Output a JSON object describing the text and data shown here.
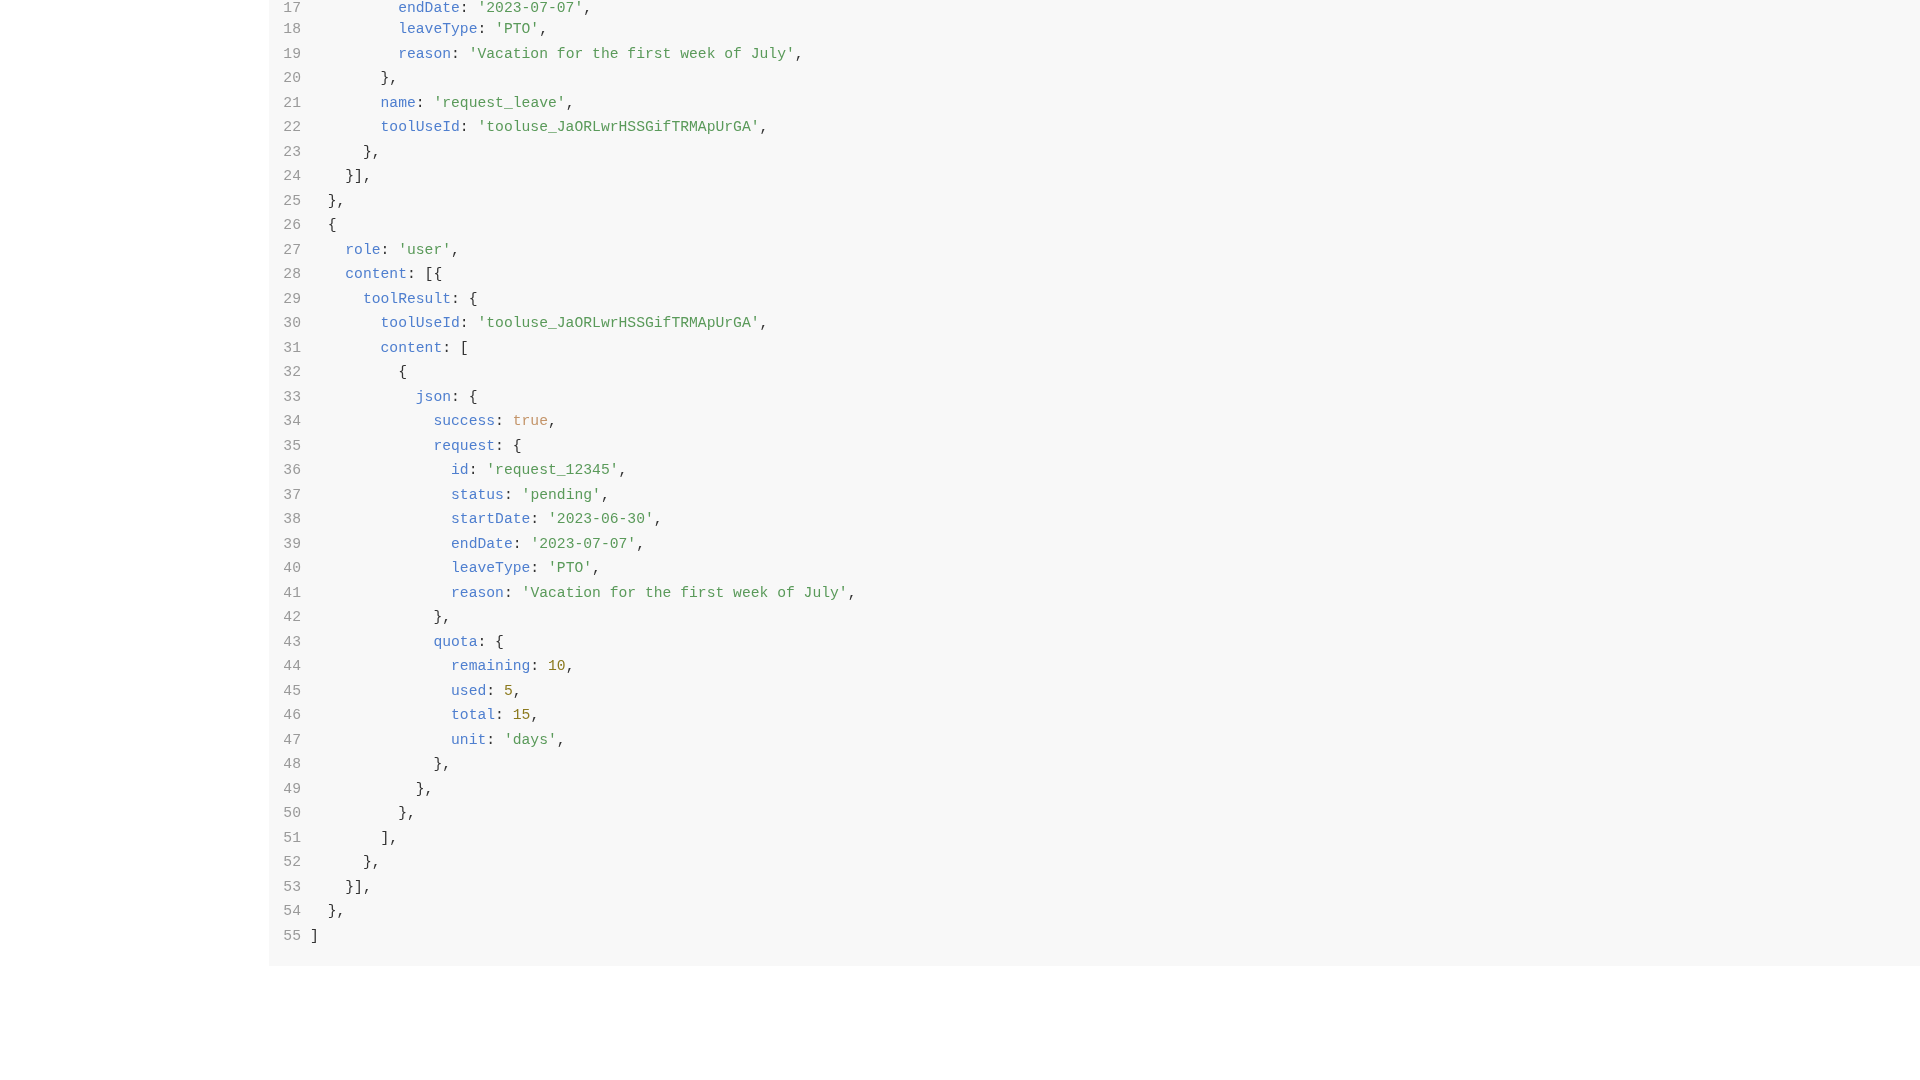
{
  "code_block": {
    "lines": [
      {
        "number": "17",
        "tokens": [
          {
            "kind": "key",
            "text": "          endDate"
          },
          {
            "kind": "punct",
            "text": ": "
          },
          {
            "kind": "string",
            "text": "'2023-07-07'"
          },
          {
            "kind": "punct",
            "text": ","
          }
        ]
      },
      {
        "number": "18",
        "tokens": [
          {
            "kind": "key",
            "text": "          leaveType"
          },
          {
            "kind": "punct",
            "text": ": "
          },
          {
            "kind": "string",
            "text": "'PTO'"
          },
          {
            "kind": "punct",
            "text": ","
          }
        ]
      },
      {
        "number": "19",
        "tokens": [
          {
            "kind": "key",
            "text": "          reason"
          },
          {
            "kind": "punct",
            "text": ": "
          },
          {
            "kind": "string",
            "text": "'Vacation for the first week of July'"
          },
          {
            "kind": "punct",
            "text": ","
          }
        ]
      },
      {
        "number": "20",
        "tokens": [
          {
            "kind": "punct",
            "text": "        },"
          }
        ]
      },
      {
        "number": "21",
        "tokens": [
          {
            "kind": "key",
            "text": "        name"
          },
          {
            "kind": "punct",
            "text": ": "
          },
          {
            "kind": "string",
            "text": "'request_leave'"
          },
          {
            "kind": "punct",
            "text": ","
          }
        ]
      },
      {
        "number": "22",
        "tokens": [
          {
            "kind": "key",
            "text": "        toolUseId"
          },
          {
            "kind": "punct",
            "text": ": "
          },
          {
            "kind": "string",
            "text": "'tooluse_JaORLwrHSSGifTRMApUrGA'"
          },
          {
            "kind": "punct",
            "text": ","
          }
        ]
      },
      {
        "number": "23",
        "tokens": [
          {
            "kind": "punct",
            "text": "      },"
          }
        ]
      },
      {
        "number": "24",
        "tokens": [
          {
            "kind": "punct",
            "text": "    }],"
          }
        ]
      },
      {
        "number": "25",
        "tokens": [
          {
            "kind": "punct",
            "text": "  },"
          }
        ]
      },
      {
        "number": "26",
        "tokens": [
          {
            "kind": "punct",
            "text": "  {"
          }
        ]
      },
      {
        "number": "27",
        "tokens": [
          {
            "kind": "key",
            "text": "    role"
          },
          {
            "kind": "punct",
            "text": ": "
          },
          {
            "kind": "string",
            "text": "'user'"
          },
          {
            "kind": "punct",
            "text": ","
          }
        ]
      },
      {
        "number": "28",
        "tokens": [
          {
            "kind": "key",
            "text": "    content"
          },
          {
            "kind": "punct",
            "text": ": [{"
          }
        ]
      },
      {
        "number": "29",
        "tokens": [
          {
            "kind": "key",
            "text": "      toolResult"
          },
          {
            "kind": "punct",
            "text": ": {"
          }
        ]
      },
      {
        "number": "30",
        "tokens": [
          {
            "kind": "key",
            "text": "        toolUseId"
          },
          {
            "kind": "punct",
            "text": ": "
          },
          {
            "kind": "string",
            "text": "'tooluse_JaORLwrHSSGifTRMApUrGA'"
          },
          {
            "kind": "punct",
            "text": ","
          }
        ]
      },
      {
        "number": "31",
        "tokens": [
          {
            "kind": "key",
            "text": "        content"
          },
          {
            "kind": "punct",
            "text": ": ["
          }
        ]
      },
      {
        "number": "32",
        "tokens": [
          {
            "kind": "punct",
            "text": "          {"
          }
        ]
      },
      {
        "number": "33",
        "tokens": [
          {
            "kind": "key",
            "text": "            json"
          },
          {
            "kind": "punct",
            "text": ": {"
          }
        ]
      },
      {
        "number": "34",
        "tokens": [
          {
            "kind": "key",
            "text": "              success"
          },
          {
            "kind": "punct",
            "text": ": "
          },
          {
            "kind": "boolean",
            "text": "true"
          },
          {
            "kind": "punct",
            "text": ","
          }
        ]
      },
      {
        "number": "35",
        "tokens": [
          {
            "kind": "key",
            "text": "              request"
          },
          {
            "kind": "punct",
            "text": ": {"
          }
        ]
      },
      {
        "number": "36",
        "tokens": [
          {
            "kind": "key",
            "text": "                id"
          },
          {
            "kind": "punct",
            "text": ": "
          },
          {
            "kind": "string",
            "text": "'request_12345'"
          },
          {
            "kind": "punct",
            "text": ","
          }
        ]
      },
      {
        "number": "37",
        "tokens": [
          {
            "kind": "key",
            "text": "                status"
          },
          {
            "kind": "punct",
            "text": ": "
          },
          {
            "kind": "string",
            "text": "'pending'"
          },
          {
            "kind": "punct",
            "text": ","
          }
        ]
      },
      {
        "number": "38",
        "tokens": [
          {
            "kind": "key",
            "text": "                startDate"
          },
          {
            "kind": "punct",
            "text": ": "
          },
          {
            "kind": "string",
            "text": "'2023-06-30'"
          },
          {
            "kind": "punct",
            "text": ","
          }
        ]
      },
      {
        "number": "39",
        "tokens": [
          {
            "kind": "key",
            "text": "                endDate"
          },
          {
            "kind": "punct",
            "text": ": "
          },
          {
            "kind": "string",
            "text": "'2023-07-07'"
          },
          {
            "kind": "punct",
            "text": ","
          }
        ]
      },
      {
        "number": "40",
        "tokens": [
          {
            "kind": "key",
            "text": "                leaveType"
          },
          {
            "kind": "punct",
            "text": ": "
          },
          {
            "kind": "string",
            "text": "'PTO'"
          },
          {
            "kind": "punct",
            "text": ","
          }
        ]
      },
      {
        "number": "41",
        "tokens": [
          {
            "kind": "key",
            "text": "                reason"
          },
          {
            "kind": "punct",
            "text": ": "
          },
          {
            "kind": "string",
            "text": "'Vacation for the first week of July'"
          },
          {
            "kind": "punct",
            "text": ","
          }
        ]
      },
      {
        "number": "42",
        "tokens": [
          {
            "kind": "punct",
            "text": "              },"
          }
        ]
      },
      {
        "number": "43",
        "tokens": [
          {
            "kind": "key",
            "text": "              quota"
          },
          {
            "kind": "punct",
            "text": ": {"
          }
        ]
      },
      {
        "number": "44",
        "tokens": [
          {
            "kind": "key",
            "text": "                remaining"
          },
          {
            "kind": "punct",
            "text": ": "
          },
          {
            "kind": "number",
            "text": "10"
          },
          {
            "kind": "punct",
            "text": ","
          }
        ]
      },
      {
        "number": "45",
        "tokens": [
          {
            "kind": "key",
            "text": "                used"
          },
          {
            "kind": "punct",
            "text": ": "
          },
          {
            "kind": "number",
            "text": "5"
          },
          {
            "kind": "punct",
            "text": ","
          }
        ]
      },
      {
        "number": "46",
        "tokens": [
          {
            "kind": "key",
            "text": "                total"
          },
          {
            "kind": "punct",
            "text": ": "
          },
          {
            "kind": "number",
            "text": "15"
          },
          {
            "kind": "punct",
            "text": ","
          }
        ]
      },
      {
        "number": "47",
        "tokens": [
          {
            "kind": "key",
            "text": "                unit"
          },
          {
            "kind": "punct",
            "text": ": "
          },
          {
            "kind": "string",
            "text": "'days'"
          },
          {
            "kind": "punct",
            "text": ","
          }
        ]
      },
      {
        "number": "48",
        "tokens": [
          {
            "kind": "punct",
            "text": "              },"
          }
        ]
      },
      {
        "number": "49",
        "tokens": [
          {
            "kind": "punct",
            "text": "            },"
          }
        ]
      },
      {
        "number": "50",
        "tokens": [
          {
            "kind": "punct",
            "text": "          },"
          }
        ]
      },
      {
        "number": "51",
        "tokens": [
          {
            "kind": "punct",
            "text": "        ],"
          }
        ]
      },
      {
        "number": "52",
        "tokens": [
          {
            "kind": "punct",
            "text": "      },"
          }
        ]
      },
      {
        "number": "53",
        "tokens": [
          {
            "kind": "punct",
            "text": "    }],"
          }
        ]
      },
      {
        "number": "54",
        "tokens": [
          {
            "kind": "punct",
            "text": "  },"
          }
        ]
      },
      {
        "number": "55",
        "tokens": [
          {
            "kind": "punct",
            "text": "]"
          }
        ]
      }
    ]
  }
}
